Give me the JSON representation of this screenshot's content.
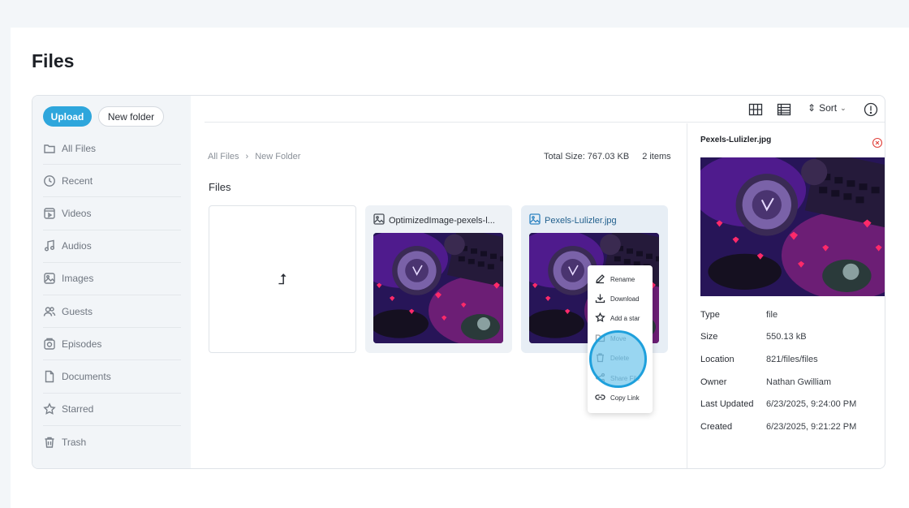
{
  "page": {
    "title": "Files"
  },
  "sidebar": {
    "upload_label": "Upload",
    "new_folder_label": "New folder",
    "items": [
      {
        "label": "All Files",
        "icon": "folder-icon"
      },
      {
        "label": "Recent",
        "icon": "clock-icon"
      },
      {
        "label": "Videos",
        "icon": "video-icon"
      },
      {
        "label": "Audios",
        "icon": "music-icon"
      },
      {
        "label": "Images",
        "icon": "image-icon"
      },
      {
        "label": "Guests",
        "icon": "users-icon"
      },
      {
        "label": "Episodes",
        "icon": "podcast-icon"
      },
      {
        "label": "Documents",
        "icon": "document-icon"
      },
      {
        "label": "Starred",
        "icon": "star-icon"
      },
      {
        "label": "Trash",
        "icon": "trash-icon"
      }
    ]
  },
  "toolbar": {
    "sort_label": "Sort"
  },
  "breadcrumb": {
    "root": "All Files",
    "current": "New Folder"
  },
  "summary": {
    "total_size": "Total Size: 767.03 KB",
    "count": "2 items"
  },
  "files_section": {
    "title": "Files",
    "up_symbol": "⮥"
  },
  "files": [
    {
      "name": "OptimizedImage-pexels-l...",
      "selected": false
    },
    {
      "name": "Pexels-Lulizler.jpg",
      "selected": true
    }
  ],
  "context_menu": {
    "items": [
      {
        "label": "Rename",
        "icon": "pencil-icon"
      },
      {
        "label": "Download",
        "icon": "download-icon"
      },
      {
        "label": "Add a star",
        "icon": "star-icon"
      },
      {
        "label": "Move",
        "icon": "folder-icon"
      },
      {
        "label": "Delete",
        "icon": "trash-icon"
      },
      {
        "label": "Share File",
        "icon": "share-icon"
      },
      {
        "label": "Copy Link",
        "icon": "link-icon"
      }
    ]
  },
  "details": {
    "file_name": "Pexels-Lulizler.jpg",
    "rows": [
      {
        "key": "Type",
        "value": "file"
      },
      {
        "key": "Size",
        "value": "550.13 kB"
      },
      {
        "key": "Location",
        "value": "821/files/files"
      },
      {
        "key": "Owner",
        "value": "Nathan Gwilliam"
      },
      {
        "key": "Last Updated",
        "value": "6/23/2025, 9:24:00 PM"
      },
      {
        "key": "Created",
        "value": "6/23/2025, 9:21:22 PM"
      }
    ]
  },
  "colors": {
    "accent": "#2ea6dc",
    "sidebar_bg": "#f2f5f8",
    "focus_ring": "#1ea0dc"
  }
}
